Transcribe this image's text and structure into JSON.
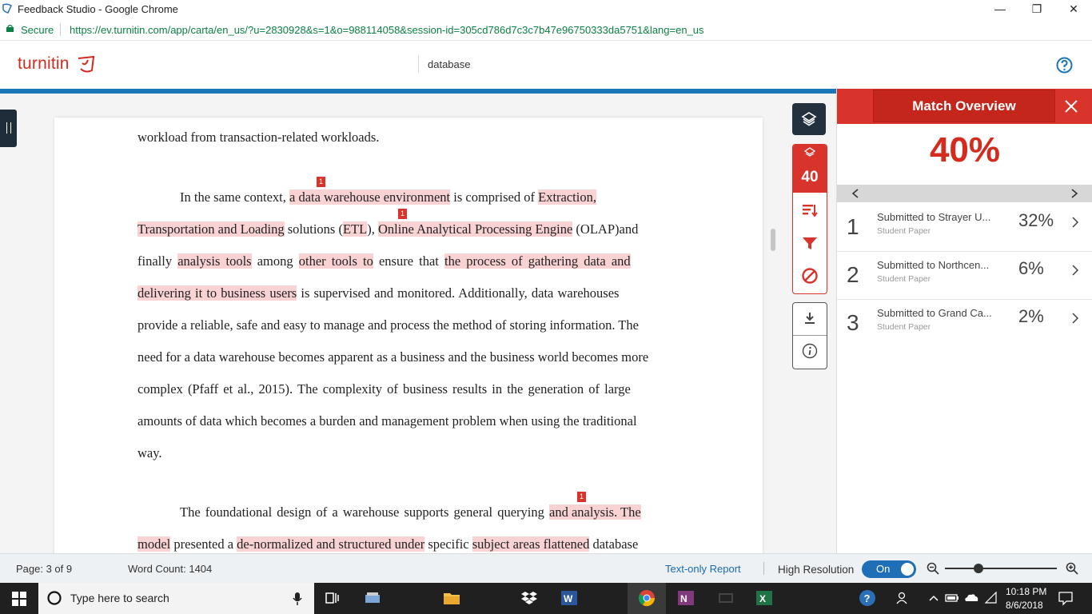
{
  "window": {
    "title": "Feedback Studio - Google Chrome",
    "minimize": "—",
    "restore": "❐",
    "close": "✕"
  },
  "address": {
    "secure_label": "Secure",
    "url": "https://ev.turnitin.com/app/carta/en_us/?u=2830928&s=1&o=988114058&session-id=305cd786d7c3c7b47e96750333da5751&lang=en_us"
  },
  "app": {
    "logo_text": "turnitin",
    "document_title": "database"
  },
  "document": {
    "line1": "workload from transaction-related workloads.",
    "p1": {
      "l1_a": "In the same context, ",
      "l1_b": "a data warehouse environment",
      "l1_c": " is comprised of ",
      "l1_d": "Extraction,",
      "l2_a": "Transportation and Loading",
      "l2_b": " solutions (",
      "l2_c": "ETL",
      "l2_d": "), ",
      "l2_e": "Online Analytical Processing Engine",
      "l2_f": " (OLAP)and",
      "l3_a": "finally ",
      "l3_b": "analysis tools",
      "l3_c": " among ",
      "l3_d": "other tools to",
      "l3_e": " ensure that ",
      "l3_f": "the process of gathering data and",
      "l4_a": "delivering it to business users",
      "l4_b": " is supervised and monitored. Additionally, data warehouses",
      "l5": "provide a reliable, safe and easy to manage and process the method of storing information. The",
      "l6": "need for a data warehouse becomes apparent as a business and the business world becomes more",
      "l7": "complex (Pfaff et al., 2015). The complexity of business results in the generation of large",
      "l8": "amounts of data which becomes a burden and management problem when using the traditional",
      "l9": "way."
    },
    "p2": {
      "l1_a": "The foundational design of a warehouse supports general querying ",
      "l1_b": "and analysis. The",
      "l2_a": "model",
      "l2_b": " presented a ",
      "l2_c": "de-normalized and structured under",
      "l2_d": " specific ",
      "l2_e": "subject areas flattened",
      "l2_f": " database"
    },
    "badge_label": "1"
  },
  "tools": {
    "similarity_score": "40"
  },
  "panel": {
    "title": "Match Overview",
    "overall_percent": "40%",
    "matches": [
      {
        "rank": "1",
        "source": "Submitted to Strayer U...",
        "type": "Student Paper",
        "percent": "32%"
      },
      {
        "rank": "2",
        "source": "Submitted to Northcen...",
        "type": "Student Paper",
        "percent": "6%"
      },
      {
        "rank": "3",
        "source": "Submitted to Grand Ca...",
        "type": "Student Paper",
        "percent": "2%"
      }
    ]
  },
  "status": {
    "page": "Page: 3 of 9",
    "word_count": "Word Count: 1404",
    "text_only": "Text-only Report",
    "high_res": "High Resolution",
    "toggle": "On",
    "zoom_level": 0.3
  },
  "taskbar": {
    "search_placeholder": "Type here to search",
    "time": "10:18 PM",
    "date": "8/6/2018"
  },
  "colors": {
    "brand_red": "#d42b1e",
    "highlight": "#f9d2d3",
    "accent_blue": "#1b77b8"
  }
}
